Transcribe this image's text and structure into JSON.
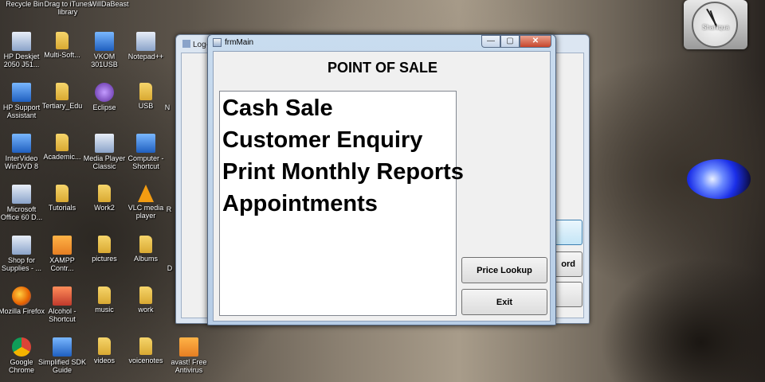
{
  "desktop": {
    "top_labels": [
      "Recycle Bin",
      "Drag to iTunes library",
      "WillDaBeast"
    ],
    "icons": [
      {
        "label": "HP Deskjet 2050 J51...",
        "icon": "printer-icon"
      },
      {
        "label": "Multi-Soft...",
        "icon": "folder-icon"
      },
      {
        "label": "VKOM 301USB",
        "icon": "app-icon"
      },
      {
        "label": "Notepad++",
        "icon": "notepad-icon"
      },
      {
        "label": "HP Support Assistant",
        "icon": "app-icon"
      },
      {
        "label": "Tertiary_Edu",
        "icon": "folder-icon"
      },
      {
        "label": "Eclipse",
        "icon": "eclipse-icon"
      },
      {
        "label": "USB",
        "icon": "folder-icon"
      },
      {
        "label": "N",
        "icon": "folder-icon"
      },
      {
        "label": "InterVideo WinDVD 8",
        "icon": "dvd-icon"
      },
      {
        "label": "Academic...",
        "icon": "folder-icon"
      },
      {
        "label": "Media Player Classic",
        "icon": "media-player-icon"
      },
      {
        "label": "Computer - Shortcut",
        "icon": "computer-icon"
      },
      {
        "label": "Microsoft Office 60 D...",
        "icon": "office-icon"
      },
      {
        "label": "Tutorials",
        "icon": "folder-icon"
      },
      {
        "label": "Work2",
        "icon": "folder-icon"
      },
      {
        "label": "VLC media player",
        "icon": "vlc-icon"
      },
      {
        "label": "R",
        "icon": "folder-icon"
      },
      {
        "label": "Shop for Supplies - ...",
        "icon": "printer-icon"
      },
      {
        "label": "XAMPP Contr...",
        "icon": "xampp-icon"
      },
      {
        "label": "pictures",
        "icon": "folder-icon"
      },
      {
        "label": "Albums",
        "icon": "folder-icon"
      },
      {
        "label": "D",
        "icon": "folder-icon"
      },
      {
        "label": "Mozilla Firefox",
        "icon": "firefox-icon"
      },
      {
        "label": "Alcohol - Shortcut",
        "icon": "alcohol-icon"
      },
      {
        "label": "music",
        "icon": "folder-icon"
      },
      {
        "label": "work",
        "icon": "folder-icon"
      },
      {
        "label": "Google Chrome",
        "icon": "chrome-icon"
      },
      {
        "label": "Simplified SDK Guide",
        "icon": "document-icon"
      },
      {
        "label": "videos",
        "icon": "folder-icon"
      },
      {
        "label": "voicenotes",
        "icon": "folder-icon"
      },
      {
        "label": "avast! Free Antivirus",
        "icon": "avast-icon"
      }
    ]
  },
  "clock_gadget": {
    "label": "Shaniqua"
  },
  "background_window": {
    "title": "Log-",
    "button_label_1": "",
    "button_label_2": "ord",
    "button_label_3": ""
  },
  "main_window": {
    "title": "frmMain",
    "heading": "POINT OF SALE",
    "menu_items": [
      "Cash Sale",
      "Customer Enquiry",
      "Print Monthly Reports",
      "Appointments"
    ],
    "price_lookup_label": "Price Lookup",
    "exit_label": "Exit",
    "caption_min": "—",
    "caption_max": "▢",
    "caption_close": "✕"
  }
}
